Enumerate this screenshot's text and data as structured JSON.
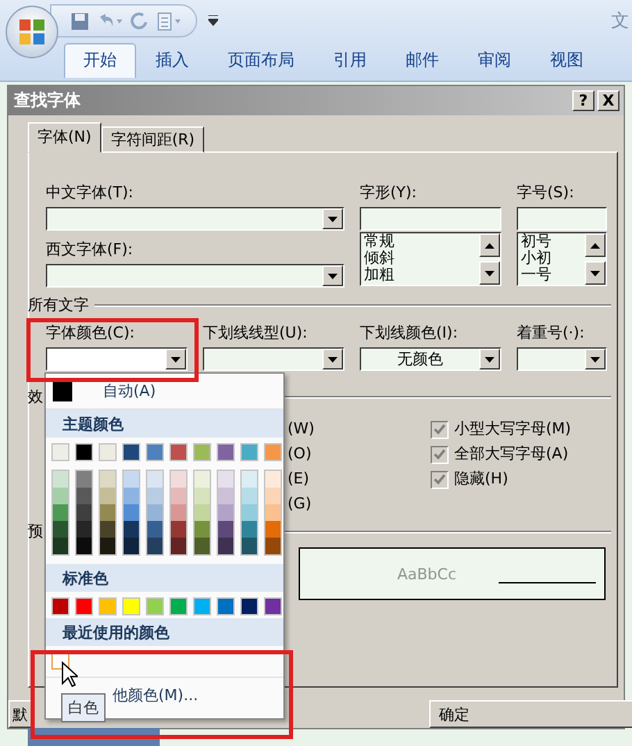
{
  "ribbon": {
    "title_fragment": "文",
    "tabs": [
      {
        "label": "开始",
        "selected": true
      },
      {
        "label": "插入",
        "selected": false
      },
      {
        "label": "页面布局",
        "selected": false
      },
      {
        "label": "引用",
        "selected": false
      },
      {
        "label": "邮件",
        "selected": false
      },
      {
        "label": "审阅",
        "selected": false
      },
      {
        "label": "视图",
        "selected": false
      }
    ]
  },
  "dialog": {
    "title": "查找字体",
    "help_button": "?",
    "close_button": "X",
    "tabs": [
      {
        "label": "字体(N)",
        "selected": true
      },
      {
        "label": "字符间距(R)",
        "selected": false
      }
    ],
    "chinese_font": {
      "label": "中文字体(T):"
    },
    "western_font": {
      "label": "西文字体(F):"
    },
    "style": {
      "label": "字形(Y):",
      "items": [
        "常规",
        "倾斜",
        "加粗"
      ]
    },
    "size": {
      "label": "字号(S):",
      "items": [
        "初号",
        "小初",
        "一号"
      ]
    },
    "all_text_heading": "所有文字",
    "font_color": {
      "label": "字体颜色(C):"
    },
    "underline_style": {
      "label": "下划线线型(U):"
    },
    "underline_color": {
      "label": "下划线颜色(I):",
      "value": "无颜色"
    },
    "emphasis": {
      "label": "着重号(·):"
    },
    "effects_heading": "效",
    "effects_left": [
      "(W)",
      "(O)",
      "(E)",
      "(G)"
    ],
    "effects_right": [
      {
        "label": "小型大写字母(M)",
        "checked": true,
        "disabled": true
      },
      {
        "label": "全部大写字母(A)",
        "checked": true,
        "disabled": true
      },
      {
        "label": "隐藏(H)",
        "checked": true,
        "disabled": true
      }
    ],
    "preview_heading": "预",
    "preview_text": "AaBbCc",
    "default_button": "默",
    "ok_button": "确定"
  },
  "color_menu": {
    "auto_label": "自动(A)",
    "theme_heading": "主题颜色",
    "theme_colors": [
      {
        "color": "#eeeee6"
      },
      {
        "color": "#000000"
      },
      {
        "color": "#eeece1"
      },
      {
        "color": "#1f497d"
      },
      {
        "color": "#4f81bd"
      },
      {
        "color": "#c0504d"
      },
      {
        "color": "#9bbb59"
      },
      {
        "color": "#8064a2"
      },
      {
        "color": "#4bacc6"
      },
      {
        "color": "#f79646"
      }
    ],
    "theme_shades": [
      [
        {
          "color": "#cfe3d2"
        },
        {
          "color": "#7f7f7f"
        },
        {
          "color": "#ddd9c3"
        },
        {
          "color": "#c6d9f0"
        },
        {
          "color": "#dbe5f1"
        },
        {
          "color": "#f2dcdb"
        },
        {
          "color": "#ebf1dd"
        },
        {
          "color": "#e5e0ec"
        },
        {
          "color": "#dbeef3"
        },
        {
          "color": "#fdeada"
        }
      ],
      [
        {
          "color": "#a3d0a7"
        },
        {
          "color": "#595959"
        },
        {
          "color": "#c4bd97"
        },
        {
          "color": "#8db3e2"
        },
        {
          "color": "#b8cce4"
        },
        {
          "color": "#e5b9b7"
        },
        {
          "color": "#d7e3bc"
        },
        {
          "color": "#ccc1d9"
        },
        {
          "color": "#b7dde8"
        },
        {
          "color": "#fbd5b5"
        }
      ],
      [
        {
          "color": "#4e9a55"
        },
        {
          "color": "#3f3f3f"
        },
        {
          "color": "#938953"
        },
        {
          "color": "#548dd4"
        },
        {
          "color": "#95b3d7"
        },
        {
          "color": "#d99694"
        },
        {
          "color": "#c3d69b"
        },
        {
          "color": "#b2a2c7"
        },
        {
          "color": "#92cddc"
        },
        {
          "color": "#fac08f"
        }
      ],
      [
        {
          "color": "#2b5730"
        },
        {
          "color": "#262626"
        },
        {
          "color": "#494429"
        },
        {
          "color": "#17365d"
        },
        {
          "color": "#366092"
        },
        {
          "color": "#953734"
        },
        {
          "color": "#76923c"
        },
        {
          "color": "#5f497a"
        },
        {
          "color": "#31859b"
        },
        {
          "color": "#e36c09"
        }
      ],
      [
        {
          "color": "#1b3a1f"
        },
        {
          "color": "#0c0c0c"
        },
        {
          "color": "#1d1b10"
        },
        {
          "color": "#0f243e"
        },
        {
          "color": "#244061"
        },
        {
          "color": "#632423"
        },
        {
          "color": "#4f6128"
        },
        {
          "color": "#3f3151"
        },
        {
          "color": "#205867"
        },
        {
          "color": "#974806"
        }
      ]
    ],
    "standard_heading": "标准色",
    "standard_colors": [
      {
        "color": "#c00000"
      },
      {
        "color": "#ff0000"
      },
      {
        "color": "#ffc000"
      },
      {
        "color": "#ffff00"
      },
      {
        "color": "#92d050"
      },
      {
        "color": "#00b050"
      },
      {
        "color": "#00b0f0"
      },
      {
        "color": "#0070c0"
      },
      {
        "color": "#002060"
      },
      {
        "color": "#7030a0"
      }
    ],
    "recent_heading": "最近使用的颜色",
    "recent_colors": [
      {
        "color": "#ffffff",
        "hovered": true
      }
    ],
    "more_label": "他颜色(M)...",
    "tooltip": "白色"
  }
}
